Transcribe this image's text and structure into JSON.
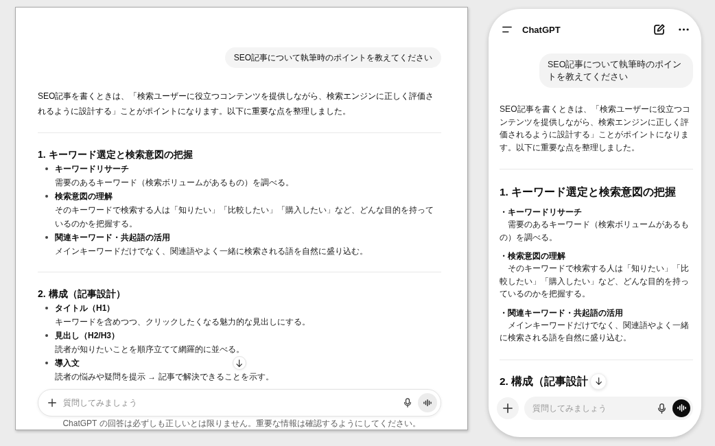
{
  "desktop": {
    "user_message": "SEO記事について執筆時のポイントを教えてください",
    "answer_intro": "SEO記事を書くときは、「検索ユーザーに役立つコンテンツを提供しながら、検索エンジンに正しく評価されるように設計する」ことがポイントになります。以下に重要な点を整理しました。",
    "sections": [
      {
        "heading": "1. キーワード選定と検索意図の把握",
        "items": [
          {
            "title": "キーワードリサーチ",
            "text": "需要のあるキーワード（検索ボリュームがあるもの）を調べる。"
          },
          {
            "title": "検索意図の理解",
            "text": "そのキーワードで検索する人は「知りたい」「比較したい」「購入したい」など、どんな目的を持っているのかを把握する。"
          },
          {
            "title": "関連キーワード・共起語の活用",
            "text": "メインキーワードだけでなく、関連語やよく一緒に検索される語を自然に盛り込む。"
          }
        ]
      },
      {
        "heading": "2. 構成（記事設計）",
        "items": [
          {
            "title": "タイトル（H1）",
            "text": "キーワードを含めつつ、クリックしたくなる魅力的な見出しにする。"
          },
          {
            "title": "見出し（H2/H3）",
            "text": "読者が知りたいことを順序立てて網羅的に並べる。"
          },
          {
            "title": "導入文",
            "text": "読者の悩みや疑問を提示 → 記事で解決できることを示す。"
          }
        ]
      }
    ],
    "composer": {
      "placeholder": "質問してみましょう"
    },
    "disclaimer": "ChatGPT の回答は必ずしも正しいとは限りません。重要な情報は確認するようにしてください。"
  },
  "mobile": {
    "header": {
      "title": "ChatGPT"
    },
    "user_message": "SEO記事について執筆時のポイントを教えてください",
    "answer_intro": "SEO記事を書くときは、「検索ユーザーに役立つコンテンツを提供しながら、検索エンジンに正しく評価されるように設計する」ことがポイントになります。以下に重要な点を整理しました。",
    "sections": [
      {
        "heading": "1. キーワード選定と検索意図の把握",
        "items": [
          {
            "title": "・キーワードリサーチ",
            "text": "需要のあるキーワード（検索ボリュームがあるもの）を調べる。"
          },
          {
            "title": "・検索意図の理解",
            "text": "そのキーワードで検索する人は「知りたい」「比較したい」「購入したい」など、どんな目的を持っているのかを把握する。"
          },
          {
            "title": "・関連キーワード・共起語の活用",
            "text": "メインキーワードだけでなく、関連語やよく一緒に検索される語を自然に盛り込む。"
          }
        ]
      },
      {
        "heading": "2. 構成（記事設計"
      }
    ],
    "composer": {
      "placeholder": "質問してみましょう"
    }
  }
}
